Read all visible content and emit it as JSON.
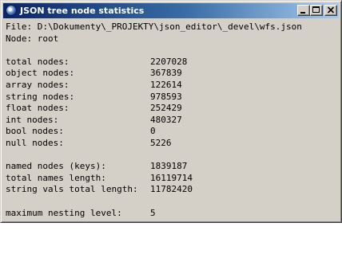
{
  "window": {
    "title": "JSON tree node statistics",
    "icon": "json-editor-app-icon"
  },
  "header": {
    "file_line": "File: D:\\Dokumenty\\_PROJEKTY\\json_editor\\_devel\\wfs.json",
    "node_line": "Node: root"
  },
  "node_stats": [
    {
      "label": "total nodes:",
      "value": "2207028"
    },
    {
      "label": "object nodes:",
      "value": "367839"
    },
    {
      "label": "array nodes:",
      "value": "122614"
    },
    {
      "label": "string nodes:",
      "value": "978593"
    },
    {
      "label": "float nodes:",
      "value": "252429"
    },
    {
      "label": "int nodes:",
      "value": "480327"
    },
    {
      "label": "bool nodes:",
      "value": "0"
    },
    {
      "label": "null nodes:",
      "value": "5226"
    }
  ],
  "name_stats": [
    {
      "label": "named nodes (keys):",
      "value": "1839187"
    },
    {
      "label": "total names length:",
      "value": "16119714"
    },
    {
      "label": "string vals total length:",
      "value": "11782420"
    }
  ],
  "nesting_stats": [
    {
      "label": "maximum nesting level:",
      "value": "5"
    }
  ]
}
